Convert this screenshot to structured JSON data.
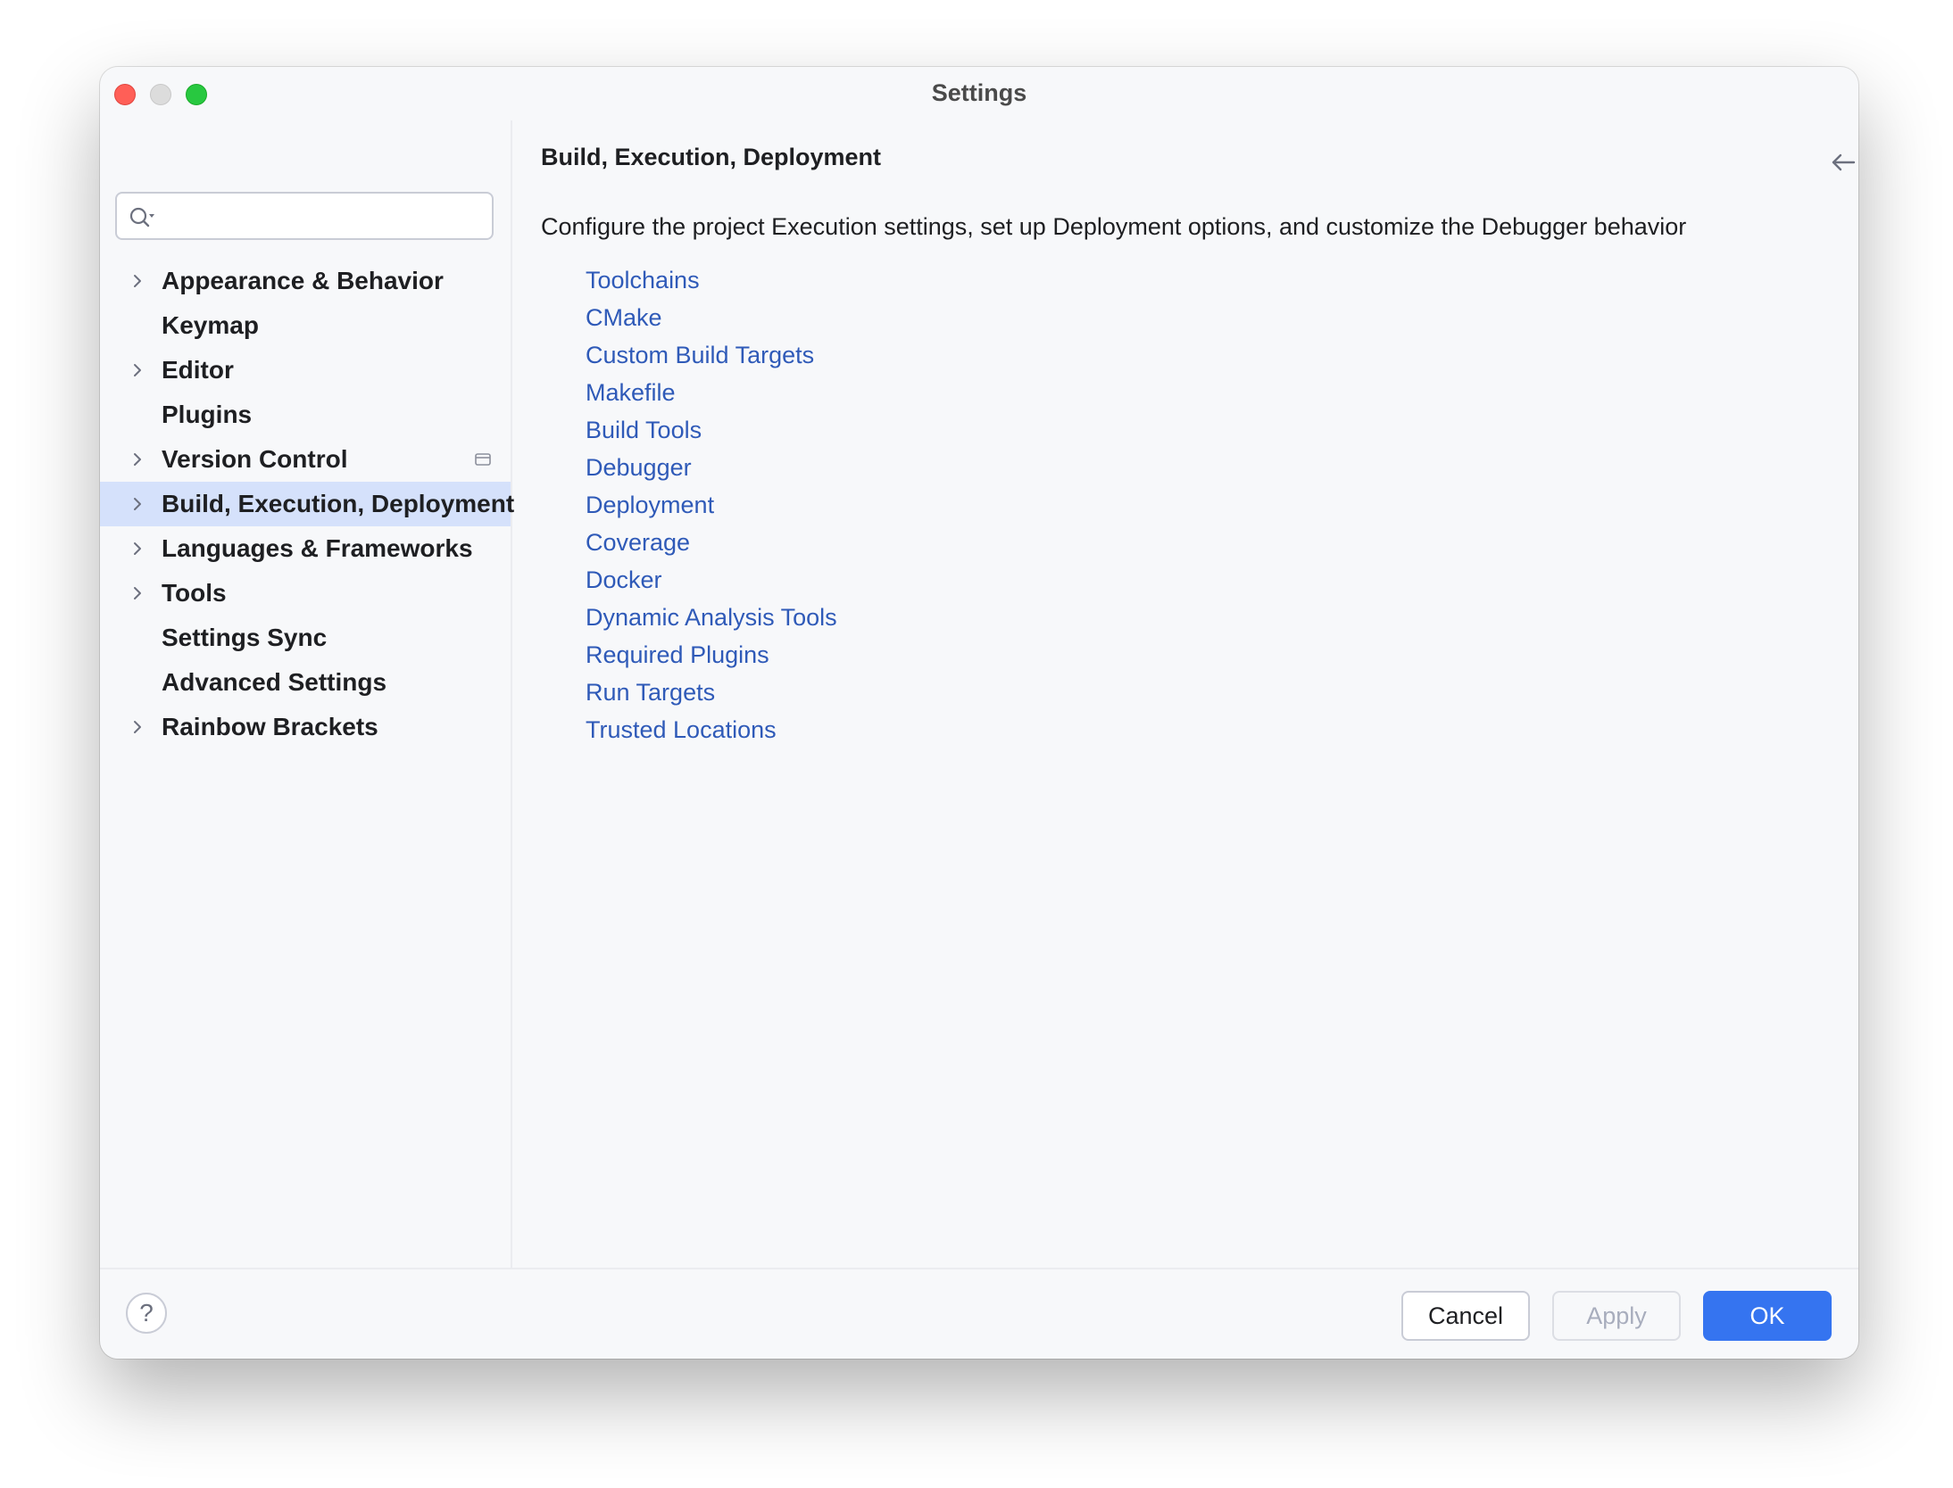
{
  "window": {
    "title": "Settings"
  },
  "search": {
    "value": "",
    "placeholder": ""
  },
  "sidebar": {
    "items": [
      {
        "label": "Appearance & Behavior",
        "expandable": true,
        "selected": false
      },
      {
        "label": "Keymap",
        "expandable": false,
        "selected": false
      },
      {
        "label": "Editor",
        "expandable": true,
        "selected": false
      },
      {
        "label": "Plugins",
        "expandable": false,
        "selected": false
      },
      {
        "label": "Version Control",
        "expandable": true,
        "selected": false,
        "icon": "project-scope-icon"
      },
      {
        "label": "Build, Execution, Deployment",
        "expandable": true,
        "selected": true
      },
      {
        "label": "Languages & Frameworks",
        "expandable": true,
        "selected": false
      },
      {
        "label": "Tools",
        "expandable": true,
        "selected": false
      },
      {
        "label": "Settings Sync",
        "expandable": false,
        "selected": false
      },
      {
        "label": "Advanced Settings",
        "expandable": false,
        "selected": false
      },
      {
        "label": "Rainbow Brackets",
        "expandable": true,
        "selected": false
      }
    ]
  },
  "main": {
    "title": "Build, Execution, Deployment",
    "description": "Configure the project Execution settings, set up Deployment options, and customize the Debugger behavior",
    "links": [
      "Toolchains",
      "CMake",
      "Custom Build Targets",
      "Makefile",
      "Build Tools",
      "Debugger",
      "Deployment",
      "Coverage",
      "Docker",
      "Dynamic Analysis Tools",
      "Required Plugins",
      "Run Targets",
      "Trusted Locations"
    ]
  },
  "footer": {
    "help_label": "?",
    "cancel_label": "Cancel",
    "apply_label": "Apply",
    "ok_label": "OK"
  },
  "colors": {
    "accent": "#3574f0",
    "link": "#2f5ab8",
    "selection": "#d5e1fb",
    "background": "#f7f8fa"
  }
}
